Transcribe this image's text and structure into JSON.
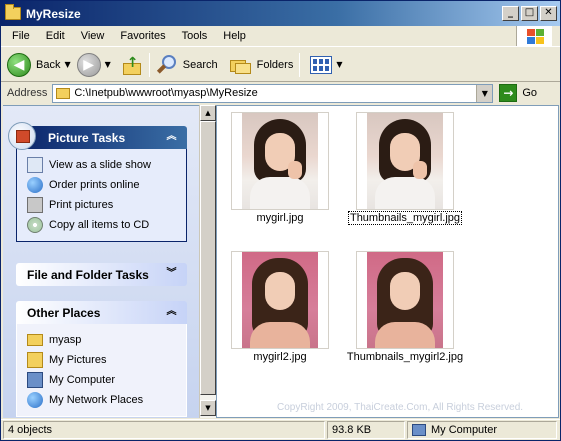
{
  "window": {
    "title": "MyResize"
  },
  "menu": [
    "File",
    "Edit",
    "View",
    "Favorites",
    "Tools",
    "Help"
  ],
  "toolbar": {
    "back": "Back",
    "search": "Search",
    "folders": "Folders"
  },
  "address": {
    "label": "Address",
    "value": "C:\\Inetpub\\wwwroot\\myasp\\MyResize",
    "go": "Go"
  },
  "taskpane": {
    "picture_tasks": {
      "title": "Picture Tasks",
      "items": [
        {
          "label": "View as a slide show",
          "icon": "slideshow-icon"
        },
        {
          "label": "Order prints online",
          "icon": "globe-icon"
        },
        {
          "label": "Print pictures",
          "icon": "printer-icon"
        },
        {
          "label": "Copy all items to CD",
          "icon": "cd-icon"
        }
      ]
    },
    "file_folder_tasks": {
      "title": "File and Folder Tasks"
    },
    "other_places": {
      "title": "Other Places",
      "items": [
        {
          "label": "myasp",
          "icon": "folder-icon"
        },
        {
          "label": "My Pictures",
          "icon": "my-pictures-icon"
        },
        {
          "label": "My Computer",
          "icon": "my-computer-icon"
        },
        {
          "label": "My Network Places",
          "icon": "network-places-icon"
        }
      ]
    }
  },
  "files": [
    {
      "name": "mygirl.jpg",
      "style": "girl1"
    },
    {
      "name": "Thumbnails_mygirl.jpg",
      "style": "girl1",
      "selected": true
    },
    {
      "name": "mygirl2.jpg",
      "style": "girl2"
    },
    {
      "name": "Thumbnails_mygirl2.jpg",
      "style": "girl2"
    }
  ],
  "watermark": "CopyRight 2009, ThaiCreate.Com, All Rights Reserved.",
  "status": {
    "objects": "4 objects",
    "size": "93.8 KB",
    "location": "My Computer"
  },
  "colors": {
    "titlebar": "#0a246a",
    "taskpane_header": "#0a246a",
    "window_bg": "#ece9d8"
  }
}
